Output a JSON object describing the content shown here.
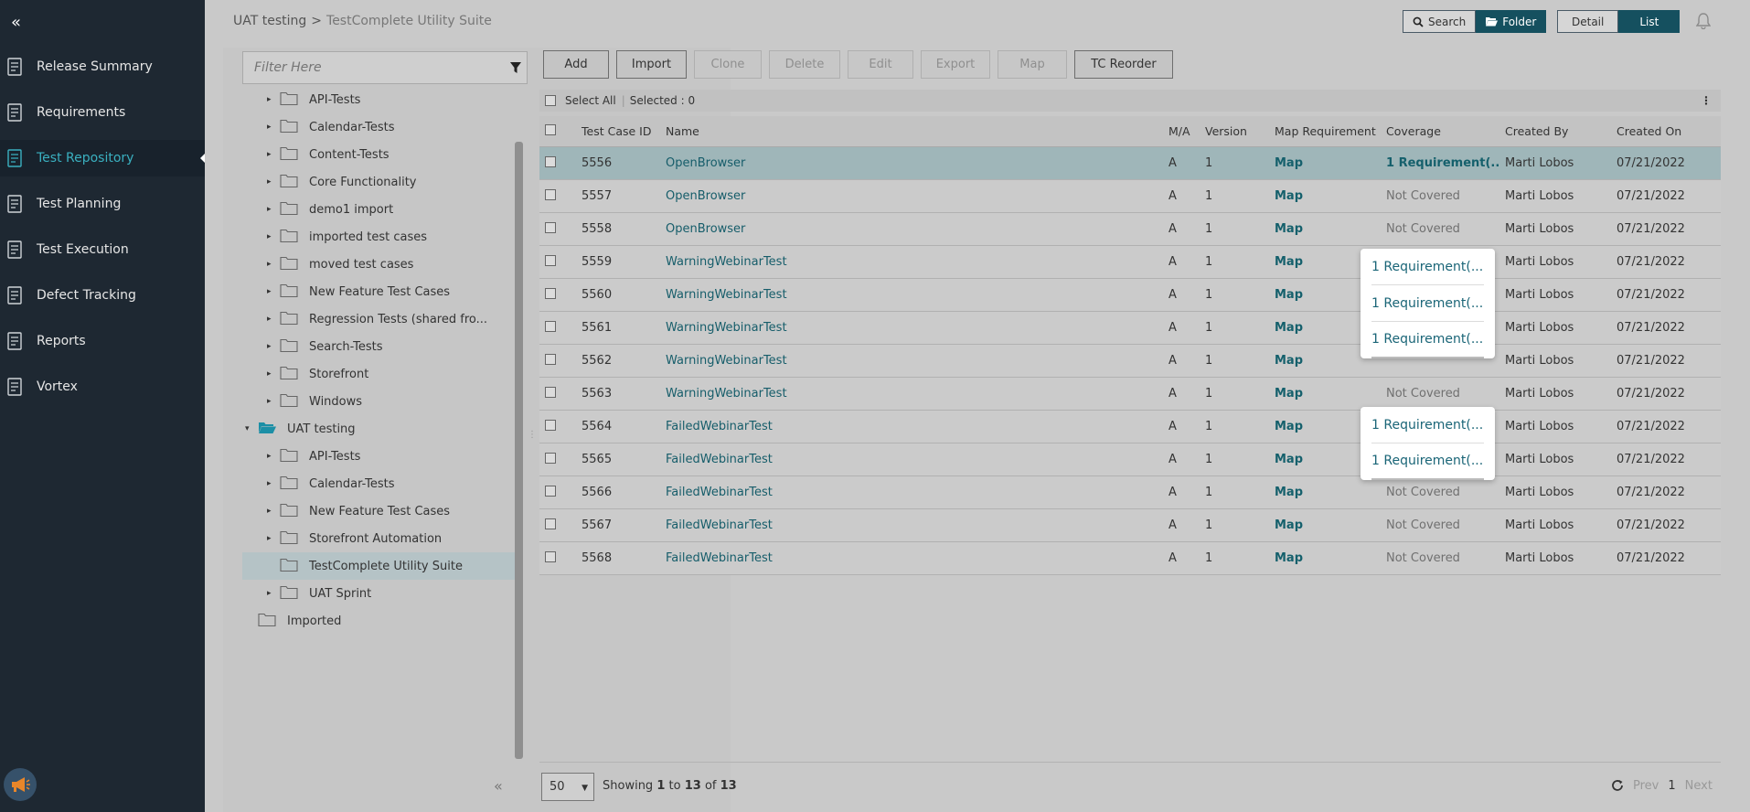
{
  "sidebar": {
    "collapse_icon": "double-chevron-left-icon",
    "items": [
      {
        "label": "Release Summary",
        "icon": "release-summary-icon",
        "active": false
      },
      {
        "label": "Requirements",
        "icon": "requirements-icon",
        "active": false
      },
      {
        "label": "Test Repository",
        "icon": "test-repository-icon",
        "active": true
      },
      {
        "label": "Test Planning",
        "icon": "test-planning-icon",
        "active": false
      },
      {
        "label": "Test Execution",
        "icon": "test-execution-icon",
        "active": false
      },
      {
        "label": "Defect Tracking",
        "icon": "defect-tracking-icon",
        "active": false
      },
      {
        "label": "Reports",
        "icon": "reports-icon",
        "active": false
      },
      {
        "label": "Vortex",
        "icon": "vortex-icon",
        "active": false
      }
    ]
  },
  "header": {
    "breadcrumb_parent": "UAT testing",
    "breadcrumb_sep": ">",
    "breadcrumb_current": "TestComplete Utility Suite",
    "search_label": "Search",
    "folder_label": "Folder",
    "detail_label": "Detail",
    "list_label": "List"
  },
  "tree": {
    "filter_placeholder": "Filter Here",
    "rows": [
      {
        "label": "API-Tests",
        "level": 1
      },
      {
        "label": "Calendar-Tests",
        "level": 1
      },
      {
        "label": "Content-Tests",
        "level": 1
      },
      {
        "label": "Core Functionality",
        "level": 1
      },
      {
        "label": "demo1 import",
        "level": 1
      },
      {
        "label": "imported test cases",
        "level": 1
      },
      {
        "label": "moved test cases",
        "level": 1
      },
      {
        "label": "New Feature Test Cases",
        "level": 1
      },
      {
        "label": "Regression Tests (shared fro...",
        "level": 1
      },
      {
        "label": "Search-Tests",
        "level": 1
      },
      {
        "label": "Storefront",
        "level": 1
      },
      {
        "label": "Windows",
        "level": 1
      },
      {
        "label": "UAT testing",
        "level": 0,
        "open": true
      },
      {
        "label": "API-Tests",
        "level": 1
      },
      {
        "label": "Calendar-Tests",
        "level": 1
      },
      {
        "label": "New Feature Test Cases",
        "level": 1
      },
      {
        "label": "Storefront Automation",
        "level": 1
      },
      {
        "label": "TestComplete Utility Suite",
        "level": 1,
        "selected": true,
        "nocaret": true
      },
      {
        "label": "UAT Sprint",
        "level": 1
      },
      {
        "label": "Imported",
        "level": 0,
        "nocaret": true
      }
    ]
  },
  "toolbar": {
    "buttons": [
      {
        "label": "Add",
        "disabled": false
      },
      {
        "label": "Import",
        "disabled": false
      },
      {
        "label": "Clone",
        "disabled": true
      },
      {
        "label": "Delete",
        "disabled": true
      },
      {
        "label": "Edit",
        "disabled": true
      },
      {
        "label": "Export",
        "disabled": true
      },
      {
        "label": "Map",
        "disabled": true
      },
      {
        "label": "TC Reorder",
        "disabled": false
      }
    ]
  },
  "selection": {
    "select_all": "Select All",
    "selected": "Selected : 0"
  },
  "table": {
    "columns": [
      "Test Case ID",
      "Name",
      "M/A",
      "Version",
      "Map Requirement",
      "Coverage",
      "Created By",
      "Created On"
    ],
    "rows": [
      {
        "id": "5556",
        "name": "OpenBrowser",
        "ma": "A",
        "version": "1",
        "map": "Map",
        "coverage": "1 Requirement(...",
        "covered": true,
        "by": "Marti Lobos",
        "on": "07/21/2022"
      },
      {
        "id": "5557",
        "name": "OpenBrowser",
        "ma": "A",
        "version": "1",
        "map": "Map",
        "coverage": "Not Covered",
        "covered": false,
        "by": "Marti Lobos",
        "on": "07/21/2022"
      },
      {
        "id": "5558",
        "name": "OpenBrowser",
        "ma": "A",
        "version": "1",
        "map": "Map",
        "coverage": "Not Covered",
        "covered": false,
        "by": "Marti Lobos",
        "on": "07/21/2022"
      },
      {
        "id": "5559",
        "name": "WarningWebinarTest",
        "ma": "A",
        "version": "1",
        "map": "Map",
        "coverage": "",
        "covered": false,
        "by": "Marti Lobos",
        "on": "07/21/2022"
      },
      {
        "id": "5560",
        "name": "WarningWebinarTest",
        "ma": "A",
        "version": "1",
        "map": "Map",
        "coverage": "",
        "covered": false,
        "by": "Marti Lobos",
        "on": "07/21/2022"
      },
      {
        "id": "5561",
        "name": "WarningWebinarTest",
        "ma": "A",
        "version": "1",
        "map": "Map",
        "coverage": "",
        "covered": false,
        "by": "Marti Lobos",
        "on": "07/21/2022"
      },
      {
        "id": "5562",
        "name": "WarningWebinarTest",
        "ma": "A",
        "version": "1",
        "map": "Map",
        "coverage": "",
        "covered": false,
        "by": "Marti Lobos",
        "on": "07/21/2022"
      },
      {
        "id": "5563",
        "name": "WarningWebinarTest",
        "ma": "A",
        "version": "1",
        "map": "Map",
        "coverage": "Not Covered",
        "covered": false,
        "by": "Marti Lobos",
        "on": "07/21/2022"
      },
      {
        "id": "5564",
        "name": "FailedWebinarTest",
        "ma": "A",
        "version": "1",
        "map": "Map",
        "coverage": "",
        "covered": false,
        "by": "Marti Lobos",
        "on": "07/21/2022"
      },
      {
        "id": "5565",
        "name": "FailedWebinarTest",
        "ma": "A",
        "version": "1",
        "map": "Map",
        "coverage": "",
        "covered": false,
        "by": "Marti Lobos",
        "on": "07/21/2022"
      },
      {
        "id": "5566",
        "name": "FailedWebinarTest",
        "ma": "A",
        "version": "1",
        "map": "Map",
        "coverage": "Not Covered",
        "covered": false,
        "by": "Marti Lobos",
        "on": "07/21/2022"
      },
      {
        "id": "5567",
        "name": "FailedWebinarTest",
        "ma": "A",
        "version": "1",
        "map": "Map",
        "coverage": "Not Covered",
        "covered": false,
        "by": "Marti Lobos",
        "on": "07/21/2022"
      },
      {
        "id": "5568",
        "name": "FailedWebinarTest",
        "ma": "A",
        "version": "1",
        "map": "Map",
        "coverage": "Not Covered",
        "covered": false,
        "by": "Marti Lobos",
        "on": "07/21/2022"
      }
    ]
  },
  "popups": {
    "first": [
      "1 Requirement(...",
      "1 Requirement(...",
      "1 Requirement(..."
    ],
    "second": [
      "1 Requirement(...",
      "1 Requirement(..."
    ]
  },
  "footer": {
    "page_size": "50",
    "showing_prefix": "Showing",
    "from": "1",
    "to_word": "to",
    "to": "13",
    "of_word": "of",
    "total": "13",
    "prev": "Prev",
    "page": "1",
    "next": "Next"
  },
  "colors": {
    "sidebar_bg": "#1e2832",
    "accent": "#15505f",
    "active_nav": "#3ab0c0",
    "link": "#15606c"
  }
}
